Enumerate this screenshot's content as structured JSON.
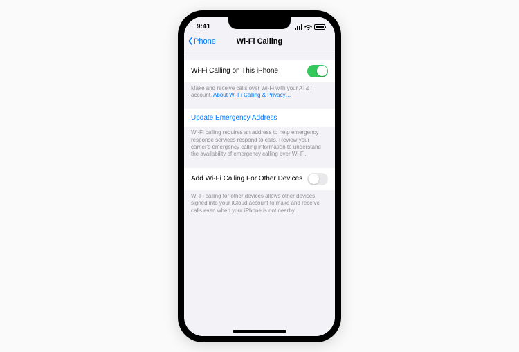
{
  "statusBar": {
    "time": "9:41"
  },
  "nav": {
    "back": "Phone",
    "title": "Wi-Fi Calling"
  },
  "rows": {
    "wifiCalling": {
      "label": "Wi-Fi Calling on This iPhone",
      "enabled": true
    },
    "wifiCallingFooter": {
      "text": "Make and receive calls over Wi-Fi with your AT&T account.",
      "link": "About Wi-Fi Calling & Privacy…"
    },
    "updateAddress": {
      "label": "Update Emergency Address"
    },
    "updateAddressFooter": "Wi-Fi calling requires an address to help emergency response services respond to calls. Review your carrier's emergency calling information to understand the availability of emergency calling over Wi-Fi.",
    "otherDevices": {
      "label": "Add Wi-Fi Calling For Other Devices",
      "enabled": false
    },
    "otherDevicesFooter": "Wi-Fi calling for other devices allows other devices signed into your iCloud account to make and receive calls even when your iPhone is not nearby."
  }
}
